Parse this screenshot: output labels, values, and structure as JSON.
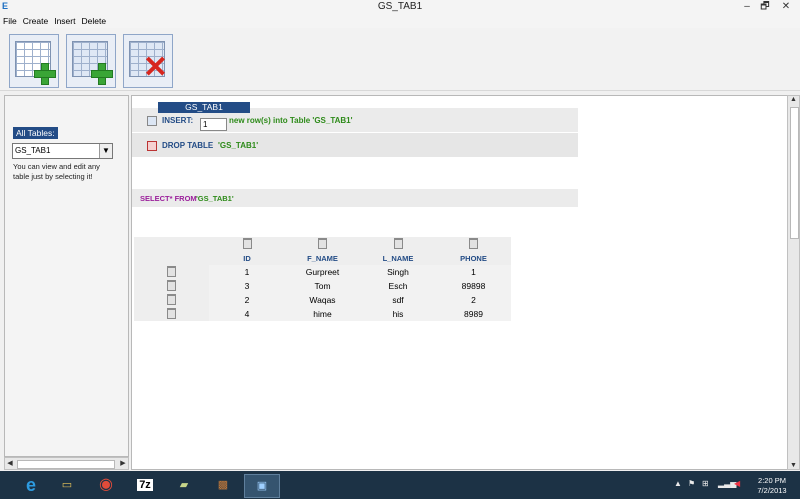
{
  "window": {
    "title": "GS_TAB1",
    "min": "–",
    "restore": "🗗",
    "close": "✕"
  },
  "menu": [
    "File",
    "Create",
    "Insert",
    "Delete"
  ],
  "toolbar": {
    "buttons": [
      "create-table-icon",
      "add-rows-icon",
      "drop-table-icon"
    ]
  },
  "sidebar": {
    "all_tables_label": "All Tables:",
    "selected_table": "GS_TAB1",
    "hint": "You can view and edit any table just by selecting it!"
  },
  "main": {
    "tab_label": "GS_TAB1",
    "insert_label": "INSERT:",
    "insert_value": "1",
    "insert_suffix": "new row(s) into Table 'GS_TAB1'",
    "drop_label": "DROP TABLE",
    "drop_table_name": "'GS_TAB1'",
    "select_prefix": "SELECT* FROM",
    "select_table": "'GS_TAB1'"
  },
  "table": {
    "columns": [
      "ID",
      "F_NAME",
      "L_NAME",
      "PHONE"
    ],
    "rows": [
      [
        "1",
        "Gurpreet",
        "Singh",
        "1"
      ],
      [
        "3",
        "Tom",
        "Esch",
        "89898"
      ],
      [
        "2",
        "Waqas",
        "sdf",
        "2"
      ],
      [
        "4",
        "hime",
        "his",
        "8989"
      ]
    ]
  },
  "taskbar": {
    "items": [
      "ie-icon",
      "explorer-icon",
      "chrome-icon",
      "7zip-icon",
      "folder-icon",
      "app-icon",
      "java-app-icon"
    ],
    "sevenzip_label": "7z",
    "time": "2:20 PM",
    "date": "7/2/2013"
  }
}
